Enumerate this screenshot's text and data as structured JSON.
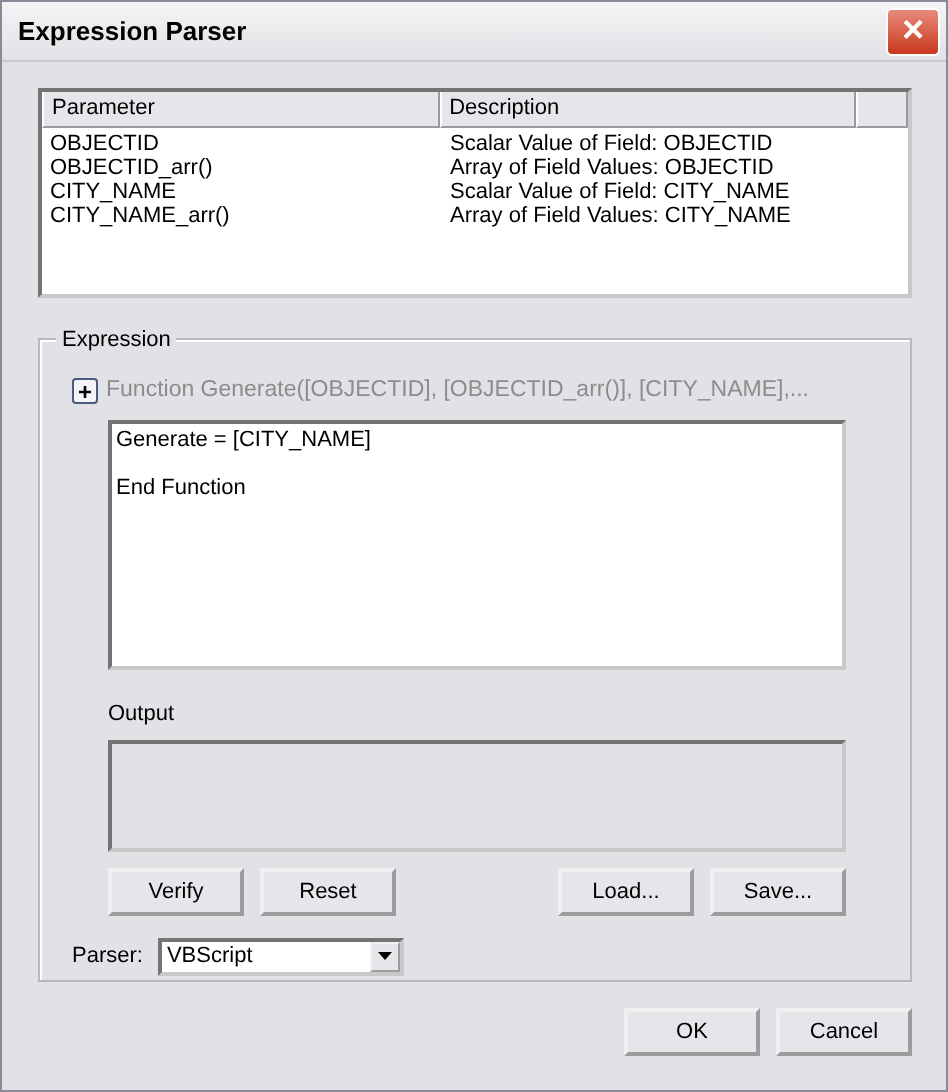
{
  "window": {
    "title": "Expression Parser",
    "close": "×"
  },
  "parameters": {
    "columns": [
      "Parameter",
      "Description"
    ],
    "rows": [
      {
        "parameter": "OBJECTID",
        "description": "Scalar Value of Field: OBJECTID"
      },
      {
        "parameter": "OBJECTID_arr()",
        "description": "Array of Field Values: OBJECTID"
      },
      {
        "parameter": "CITY_NAME",
        "description": "Scalar Value of Field: CITY_NAME"
      },
      {
        "parameter": "CITY_NAME_arr()",
        "description": "Array of Field Values: CITY_NAME"
      }
    ]
  },
  "expression": {
    "legend": "Expression",
    "expand": "+",
    "expanded": false,
    "function_header": "Function Generate([OBJECTID], [OBJECTID_arr()], [CITY_NAME],...",
    "code": "Generate = [CITY_NAME]\n\nEnd Function",
    "output_label": "Output",
    "left_buttons": [
      "Verify",
      "Reset"
    ],
    "right_buttons": [
      "Load...",
      "Save..."
    ],
    "parser_label": "Parser:",
    "parser_value": "VBScript"
  },
  "buttons": [
    "OK",
    "Cancel"
  ]
}
